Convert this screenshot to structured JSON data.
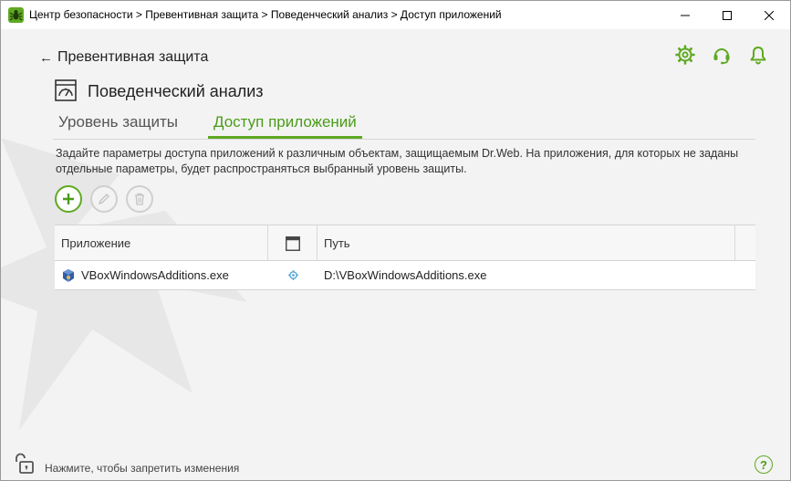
{
  "window": {
    "title": "Центр безопасности > Превентивная защита > Поведенческий анализ > Доступ приложений"
  },
  "nav": {
    "back_label": "Превентивная защита"
  },
  "section": {
    "title": "Поведенческий анализ"
  },
  "tabs": [
    {
      "label": "Уровень защиты",
      "active": false
    },
    {
      "label": "Доступ приложений",
      "active": true
    }
  ],
  "description": "Задайте параметры доступа приложений к различным объектам, защищаемым Dr.Web. На приложения, для которых не заданы отдельные параметры, будет распространяться выбранный уровень защиты.",
  "table": {
    "columns": [
      "Приложение",
      "",
      "Путь"
    ],
    "rows": [
      {
        "app": "VBoxWindowsAdditions.exe",
        "path": "D:\\VBoxWindowsAdditions.exe"
      }
    ]
  },
  "footer": {
    "lock_text": "Нажмите, чтобы запретить изменения",
    "help_label": "?"
  },
  "colors": {
    "accent": "#5fa922",
    "accent_text": "#4a9c18"
  },
  "icons": {
    "app": "dr-web-spider-icon",
    "settings": "gear-icon",
    "support": "headset-icon",
    "notifications": "bell-icon",
    "section": "behavior-analysis-icon",
    "add": "plus-icon",
    "edit": "pencil-icon",
    "delete": "trash-icon",
    "column_window": "window-icon",
    "row_app": "virtualbox-icon",
    "row_setting": "gear-small-icon",
    "lock": "unlock-icon"
  }
}
